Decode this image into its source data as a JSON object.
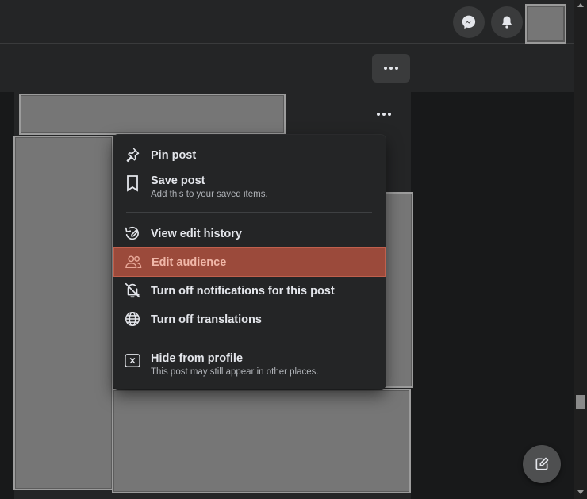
{
  "topbar": {
    "messenger_icon": "messenger-icon",
    "notifications_icon": "bell-icon"
  },
  "profile_actions": {
    "more_icon": "more-horizontal-icon"
  },
  "post": {
    "more_icon": "more-horizontal-icon"
  },
  "menu": {
    "items": [
      {
        "label": "Pin post",
        "icon": "pin-icon"
      },
      {
        "label": "Save post",
        "sublabel": "Add this to your saved items.",
        "icon": "bookmark-icon"
      },
      {
        "label": "View edit history",
        "icon": "edit-history-icon"
      },
      {
        "label": "Edit audience",
        "icon": "people-icon",
        "highlighted": true
      },
      {
        "label": "Turn off notifications for this post",
        "icon": "bell-off-icon"
      },
      {
        "label": "Turn off translations",
        "icon": "globe-icon"
      },
      {
        "label": "Hide from profile",
        "sublabel": "This post may still appear in other places.",
        "icon": "close-box-icon"
      }
    ]
  },
  "fab": {
    "icon": "compose-icon"
  },
  "colors": {
    "background": "#18191a",
    "surface": "#242526",
    "button": "#3a3b3c",
    "highlight": "#9b4a3b",
    "highlight_text": "#f0b7a8",
    "redacted": "#767676"
  }
}
